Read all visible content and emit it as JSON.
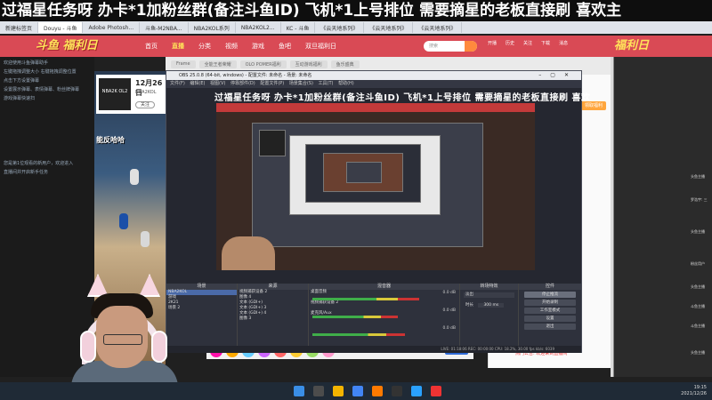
{
  "marquee": "过福星任务呀  办卡*1加粉丝群(备注斗鱼ID)  飞机*1上号排位  需要摘星的老板直接刷    喜欢主",
  "browser": {
    "tabs": [
      "新建标签页",
      "Douyu - 斗鱼",
      "Adobe Photosh...",
      "斗鱼-M2NBA...",
      "NBA2KOL系列",
      "NBA2KOL2...",
      "KC - 斗鱼",
      "《云天地系列》",
      "《云天地系列》",
      "《云天地系列》"
    ],
    "address": "https://www.douyu.com/..."
  },
  "site": {
    "logo": "斗鱼 福利日",
    "nav": [
      "首页",
      "直播",
      "分类",
      "视频",
      "游戏",
      "鱼吧",
      "双旦福利日"
    ],
    "nav_active_index": 1,
    "search_placeholder": "搜索",
    "header_icons": [
      "开播",
      "历史",
      "关注",
      "下载",
      "消息"
    ],
    "banner": "福利日",
    "content_tabs": [
      "Frame",
      "全能王者荣耀",
      "OLO POMER福利",
      "互动游戏福利",
      "鱼乐盛典"
    ]
  },
  "streamer_card": {
    "date": "12月26日",
    "subtitle": "NBA2KOL",
    "follow_label": "关注",
    "avatar_label": "NBA2K OL2"
  },
  "game_caption": "能反哈哈",
  "left_chat": [
    "欢迎使用斗鱼弹幕助手",
    "左键拖拽调整大小 右键拖拽调整位置",
    "点击下方设置弹幕",
    "设置展示弹幕、表情弹幕、粉丝牌弹幕",
    "游戏弹幕快速扫",
    "",
    "您是第1位观看的新用户，欢迎进入",
    "直播间并开启新手任务"
  ],
  "obs": {
    "title": "OBS 25.0.8 (64-bit, windows) - 配置文件: 未命名 - 场景: 未命名",
    "menu": [
      "文件(F)",
      "编辑(E)",
      "视图(V)",
      "停靠部件(D)",
      "配置文件(P)",
      "场景集合(S)",
      "工具(T)",
      "帮助(H)"
    ],
    "preview_title": "过福星任务呀  办卡*1加粉丝群(备注斗鱼ID)  飞机*1上号排位  需要摘星的老板直接刷   喜欢",
    "docks": {
      "scenes": {
        "header": "场景",
        "items": [
          "NBA2KOL",
          "游戏",
          "2K21",
          "场景 2"
        ],
        "selected_index": 0
      },
      "sources": {
        "header": "来源",
        "items": [
          "视频捕获设备 2",
          "图像 4",
          "文本 (GDI+)",
          "文本 (GDI+) 3",
          "文本 (GDI+) 4",
          "图像 3"
        ]
      },
      "mixer": {
        "header": "混音器",
        "channels": [
          {
            "name": "桌面音频",
            "db": "0.0 dB",
            "level": 0.75
          },
          {
            "name": "视频捕获设备 2",
            "db": "0.0 dB",
            "level": 0.6
          },
          {
            "name": "麦克风/Aux",
            "db": "0.0 dB",
            "level": 0.65
          }
        ]
      },
      "transitions": {
        "header": "转场特效",
        "type": "淡出",
        "duration_label": "时长",
        "duration": "300 ms"
      },
      "controls": {
        "header": "控件",
        "buttons": [
          "停止推流",
          "开始录制",
          "工作室模式",
          "设置",
          "退出"
        ],
        "highlight_index": 0
      }
    },
    "status": "LIVE: 01:18:06   REC: 00:00:00   CPU: 18.2%, 30.00 fps   kb/s: 6039"
  },
  "fan_card": {
    "button": "领取福利",
    "footer": "热门公告: 欢迎来到直播间"
  },
  "right_messages": [
    "头鱼主播",
    "罗浩宇: 三",
    "头鱼主播",
    "粉丝用户",
    "头鱼主播",
    "斗鱼主播",
    "斗鱼主播",
    "头鱼主播"
  ],
  "taskbar": {
    "time": "19:15",
    "date": "2021/12/26"
  },
  "send_label": "发送",
  "colors": {
    "site_nav": "#d94a55",
    "obs_bg": "#2b2e38",
    "accent_orange": "#ffa63d",
    "taskbar": "#1f2a36"
  }
}
